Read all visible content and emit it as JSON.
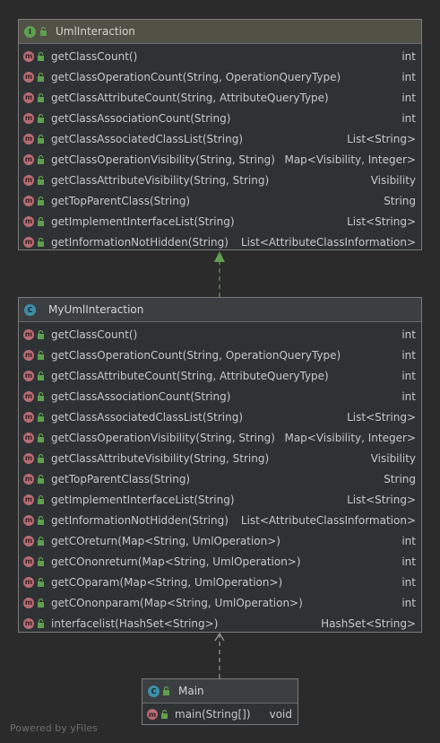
{
  "colors": {
    "background": "#2b2b2b",
    "interface_header": "#515145",
    "class_header": "#3c3f41",
    "method_badge": "#b96b73",
    "interface_badge": "#5f9f4f",
    "class_badge": "#3f8ea8",
    "arrow_green": "#5f9f4f"
  },
  "interface": {
    "badge": "I",
    "name": "UmlInteraction",
    "methods": [
      {
        "name": "getClassCount()",
        "type": "int"
      },
      {
        "name": "getClassOperationCount(String, OperationQueryType)",
        "type": "int"
      },
      {
        "name": "getClassAttributeCount(String, AttributeQueryType)",
        "type": "int"
      },
      {
        "name": "getClassAssociationCount(String)",
        "type": "int"
      },
      {
        "name": "getClassAssociatedClassList(String)",
        "type": "List<String>"
      },
      {
        "name": "getClassOperationVisibility(String, String)",
        "type": "Map<Visibility, Integer>"
      },
      {
        "name": "getClassAttributeVisibility(String, String)",
        "type": "Visibility"
      },
      {
        "name": "getTopParentClass(String)",
        "type": "String"
      },
      {
        "name": "getImplementInterfaceList(String)",
        "type": "List<String>"
      },
      {
        "name": "getInformationNotHidden(String)",
        "type": "List<AttributeClassInformation>"
      }
    ]
  },
  "impl_class": {
    "badge": "C",
    "name": "MyUmlInteraction",
    "methods": [
      {
        "name": "getClassCount()",
        "type": "int"
      },
      {
        "name": "getClassOperationCount(String, OperationQueryType)",
        "type": "int"
      },
      {
        "name": "getClassAttributeCount(String, AttributeQueryType)",
        "type": "int"
      },
      {
        "name": "getClassAssociationCount(String)",
        "type": "int"
      },
      {
        "name": "getClassAssociatedClassList(String)",
        "type": "List<String>"
      },
      {
        "name": "getClassOperationVisibility(String, String)",
        "type": "Map<Visibility, Integer>"
      },
      {
        "name": "getClassAttributeVisibility(String, String)",
        "type": "Visibility"
      },
      {
        "name": "getTopParentClass(String)",
        "type": "String"
      },
      {
        "name": "getImplementInterfaceList(String)",
        "type": "List<String>"
      },
      {
        "name": "getInformationNotHidden(String)",
        "type": "List<AttributeClassInformation>"
      },
      {
        "name": "getCOreturn(Map<String, UmlOperation>)",
        "type": "int"
      },
      {
        "name": "getCOnonreturn(Map<String, UmlOperation>)",
        "type": "int"
      },
      {
        "name": "getCOparam(Map<String, UmlOperation>)",
        "type": "int"
      },
      {
        "name": "getCOnonparam(Map<String, UmlOperation>)",
        "type": "int"
      },
      {
        "name": "interfacelist(HashSet<String>)",
        "type": "HashSet<String>"
      }
    ]
  },
  "main_class": {
    "badge": "C",
    "name": "Main",
    "methods": [
      {
        "name": "main(String[])",
        "type": "void"
      }
    ]
  },
  "method_badge": "m",
  "footer": "Powered by yFiles"
}
